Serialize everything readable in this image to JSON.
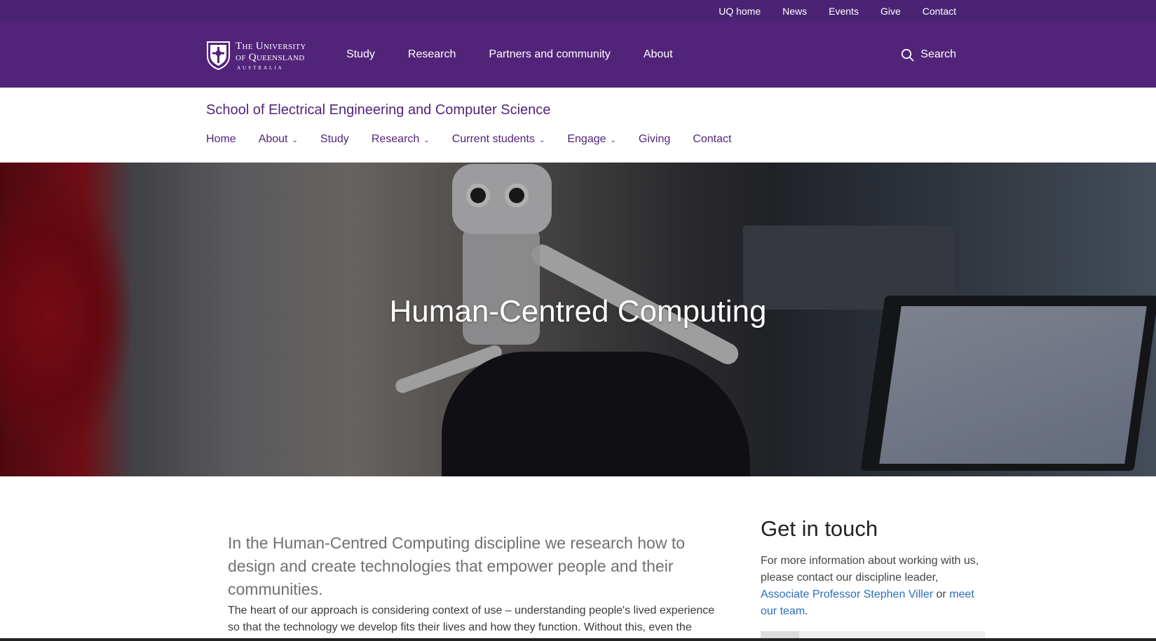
{
  "utility_nav": [
    "UQ home",
    "News",
    "Events",
    "Give",
    "Contact"
  ],
  "logo": {
    "line1": "The University",
    "line2": "of Queensland",
    "line3": "AUSTRALIA"
  },
  "global_nav": [
    "Study",
    "Research",
    "Partners and community",
    "About"
  ],
  "search": {
    "label": "Search",
    "icon": "search-icon"
  },
  "site": {
    "title": "School of Electrical Engineering and Computer Science",
    "nav": [
      {
        "label": "Home",
        "dropdown": false
      },
      {
        "label": "About",
        "dropdown": true
      },
      {
        "label": "Study",
        "dropdown": false
      },
      {
        "label": "Research",
        "dropdown": true
      },
      {
        "label": "Current students",
        "dropdown": true
      },
      {
        "label": "Engage",
        "dropdown": true
      },
      {
        "label": "Giving",
        "dropdown": false
      },
      {
        "label": "Contact",
        "dropdown": false
      }
    ]
  },
  "hero": {
    "title": "Human-Centred Computing"
  },
  "main": {
    "lead": "In the Human-Centred Computing discipline we research how to design and create technologies that empower people and their communities.",
    "body": "The heart of our approach is considering context of use – understanding people's lived experience so that the technology we develop fits their lives and how they function. Without this, even the most technically excellent technology will fail."
  },
  "aside": {
    "heading": "Get in touch",
    "text1": "For more information about working with us, please contact our discipline leader, ",
    "link1": "Associate Professor Stephen Viller",
    "text2": " or ",
    "link2": "meet our team",
    "text3": "."
  },
  "colors": {
    "brand_purple": "#51247a",
    "utility_purple": "#4a2373",
    "link_blue": "#2a6ebb"
  }
}
